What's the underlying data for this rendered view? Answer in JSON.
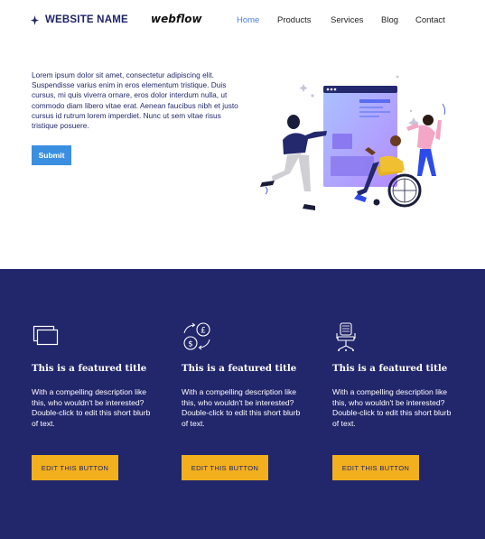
{
  "nav": {
    "brand": "WEBSITE NAME",
    "webflow_logo": "webflow",
    "links": [
      {
        "label": "Home",
        "active": true
      },
      {
        "label": "Products",
        "active": false
      },
      {
        "label": "Services",
        "active": false
      },
      {
        "label": "Blog",
        "active": false
      },
      {
        "label": "Contact",
        "active": false
      }
    ]
  },
  "hero": {
    "paragraph": "Lorem ipsum dolor sit amet, consectetur adipiscing elit. Suspendisse varius enim in eros elementum tristique. Duis cursus, mi quis viverra ornare, eros dolor interdum nulla, ut commodo diam libero vitae erat. Aenean faucibus nibh et justo cursus id rutrum lorem imperdiet. Nunc ut sem vitae risus tristique posuere.",
    "submit_label": "Submit"
  },
  "features": [
    {
      "icon": "windows-icon",
      "title": "This is a featured title",
      "description": "With a compelling description like this, who wouldn't be interested? Double-click to edit this short blurb of text.",
      "button_label": "EDIT THIS BUTTON"
    },
    {
      "icon": "currency-exchange-icon",
      "title": "This is a featured title",
      "description": "With a compelling description like this, who wouldn't be interested? Double-click to edit this short blurb of text.",
      "button_label": "EDIT THIS BUTTON"
    },
    {
      "icon": "office-chair-icon",
      "title": "This is a featured title",
      "description": "With a compelling description like this, who wouldn't be interested? Double-click to edit this short blurb of text.",
      "button_label": "EDIT THIS BUTTON"
    }
  ],
  "colors": {
    "brand_navy": "#22266b",
    "accent_blue": "#3b8fe0",
    "nav_active": "#4a7fd6",
    "button_yellow": "#f2b01e"
  }
}
